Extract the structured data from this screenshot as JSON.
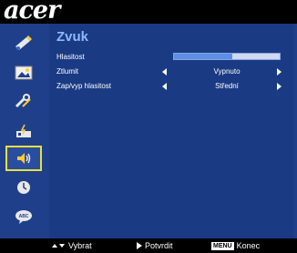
{
  "brand": {
    "logo_text": "acer"
  },
  "sidebar": {
    "items": [
      {
        "name": "color",
        "icon": "color-icon"
      },
      {
        "name": "image",
        "icon": "image-icon"
      },
      {
        "name": "settings",
        "icon": "settings-icon"
      },
      {
        "name": "management",
        "icon": "management-icon"
      },
      {
        "name": "audio",
        "icon": "speaker-icon",
        "active": true
      },
      {
        "name": "timer",
        "icon": "timer-icon"
      },
      {
        "name": "language",
        "icon": "language-icon"
      }
    ]
  },
  "main": {
    "title": "Zvuk",
    "rows": [
      {
        "label": "Hlasitost",
        "type": "slider",
        "value_fraction": 0.55
      },
      {
        "label": "Ztlumit",
        "type": "select",
        "value": "Vypnuto"
      },
      {
        "label": "Zap/vyp hlasitost",
        "type": "select",
        "value": "Střední"
      }
    ]
  },
  "footer": {
    "select_label": "Vybrat",
    "confirm_label": "Potvrdit",
    "menu_key": "MENU",
    "exit_label": "Konec"
  },
  "colors": {
    "panel": "#1a3a84",
    "sidebar": "#1f3f8a",
    "title": "#8fb8ff",
    "active_border": "#e6e040",
    "slider_fill": "#5d8fe6"
  }
}
